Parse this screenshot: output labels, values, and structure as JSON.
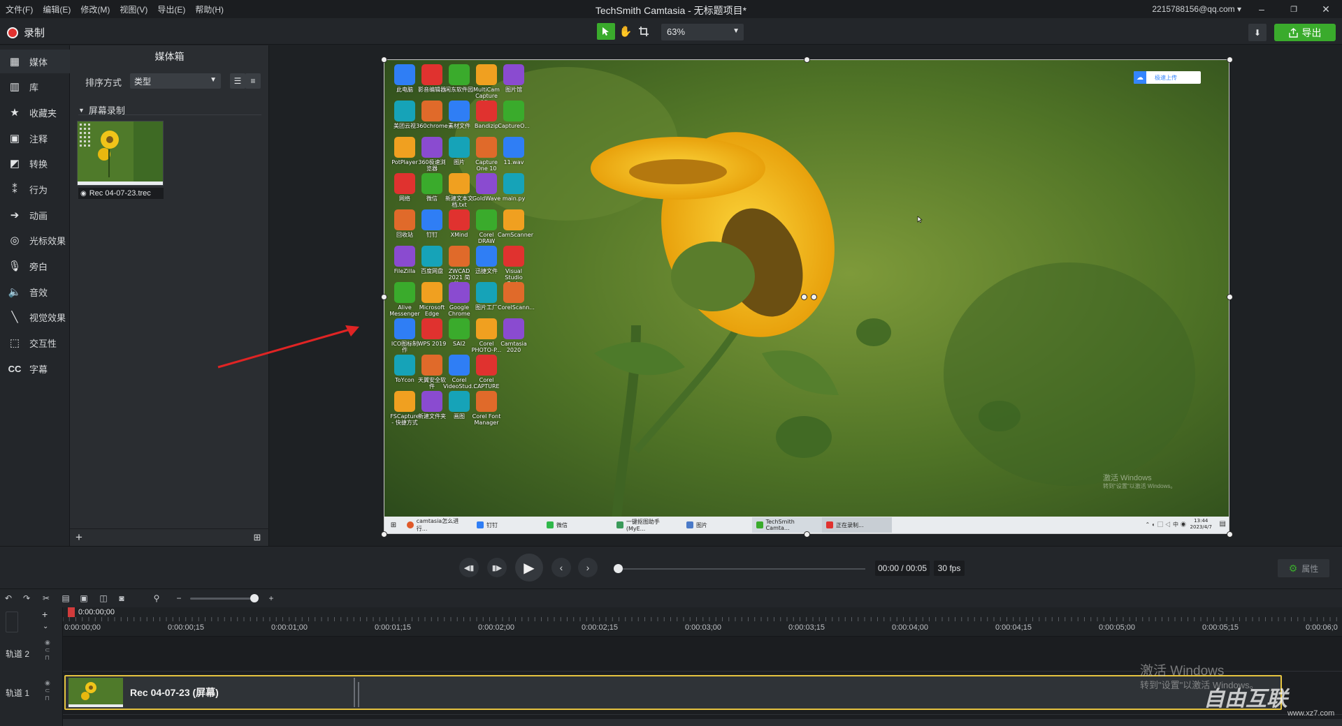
{
  "titlebar": {
    "menu": [
      "文件(F)",
      "编辑(E)",
      "修改(M)",
      "视图(V)",
      "导出(E)",
      "帮助(H)"
    ],
    "title": "TechSmith Camtasia - 无标题项目*",
    "account": "2215788156@qq.com",
    "minimize": "–",
    "maximize": "❐",
    "close": "✕"
  },
  "toolbar": {
    "record_label": "录制",
    "zoom_value": "63%",
    "export_label": "导出"
  },
  "sidebar": {
    "items": [
      {
        "label": "媒体",
        "icon": "media-icon"
      },
      {
        "label": "库",
        "icon": "library-icon"
      },
      {
        "label": "收藏夹",
        "icon": "star-icon"
      },
      {
        "label": "注释",
        "icon": "annotation-icon"
      },
      {
        "label": "转换",
        "icon": "transition-icon"
      },
      {
        "label": "行为",
        "icon": "behavior-icon"
      },
      {
        "label": "动画",
        "icon": "animation-icon"
      },
      {
        "label": "光标效果",
        "icon": "cursor-effect-icon"
      },
      {
        "label": "旁白",
        "icon": "microphone-icon"
      },
      {
        "label": "音效",
        "icon": "speaker-icon"
      },
      {
        "label": "视觉效果",
        "icon": "wand-icon"
      },
      {
        "label": "交互性",
        "icon": "interactivity-icon"
      },
      {
        "label": "字幕",
        "icon": "captions-icon"
      }
    ]
  },
  "mediabin": {
    "header": "媒体箱",
    "sort_label": "排序方式",
    "sort_value": "类型",
    "group_label": "屏幕录制",
    "clip_name": "Rec 04-07-23.trec"
  },
  "desktop": {
    "icons": [
      [
        "此电脑",
        "影音编辑器",
        "闲东软件园",
        "MultiCam Capture Lite",
        "图片馆"
      ],
      [
        "美团云视",
        "360chrome",
        "素材文件",
        "Bandizip",
        "CaptureO..."
      ],
      [
        "PotPlayer",
        "360极速浏览器",
        "图片",
        "Capture One 10",
        "11.wav"
      ],
      [
        "网络",
        "微信",
        "新建文本文档.txt",
        "GoldWave",
        "main.py"
      ],
      [
        "回收站",
        "钉钉",
        "XMind",
        "Corel DRAW",
        "CamScanner"
      ],
      [
        "FileZilla",
        "百度网盘",
        "ZWCAD 2021 简体...",
        "迅捷文件",
        "Visual Studio Code"
      ],
      [
        "Alive Messenger",
        "Microsoft Edge",
        "Google Chrome",
        "图片工厂",
        "CorelScann..."
      ],
      [
        "ICO图标制作",
        "WPS 2019",
        "SAI2",
        "Corel PHOTO-P...",
        "Camtasia 2020"
      ],
      [
        "ToYcon",
        "天翼安全软件",
        "Corel VideoStud...",
        "Corel CAPTURE",
        ""
      ],
      [
        "FSCapture - 快捷方式",
        "新建文件夹",
        "画图",
        "Corel Font Manager",
        ""
      ]
    ],
    "badge": "极速上传",
    "watermark_line1": "激活 Windows",
    "watermark_line2": "转到\"设置\"以激活 Windows。",
    "taskbar": [
      "camtasia怎么进行...",
      "钉钉",
      "微信",
      "一键抠图助手(MyE...",
      "图片",
      "TechSmith Camta...",
      "正在录制..."
    ],
    "clock_time": "13:44",
    "clock_date": "2023/4/7"
  },
  "playback": {
    "time": "00:00 / 00:05",
    "fps": "30 fps",
    "properties_label": "属性"
  },
  "timeline": {
    "playhead_time": "0:00:00;00",
    "ticks": [
      "0:00:00;00",
      "0:00:00;15",
      "0:00:01;00",
      "0:00:01;15",
      "0:00:02;00",
      "0:00:02;15",
      "0:00:03;00",
      "0:00:03;15",
      "0:00:04;00",
      "0:00:04;15",
      "0:00:05;00",
      "0:00:05;15",
      "0:00:06;0"
    ],
    "tracks": [
      "轨道 2",
      "轨道 1"
    ],
    "clip_label": "Rec 04-07-23 (屏幕)",
    "watermark_line1": "激活 Windows",
    "watermark_line2": "转到\"设置\"以激活 Windows。",
    "site_logo": "自由互联",
    "site_url": "www.xz7.com"
  },
  "colors": {
    "accent": "#3aab2c",
    "record": "#e0322f",
    "clip_border": "#e6c440"
  }
}
